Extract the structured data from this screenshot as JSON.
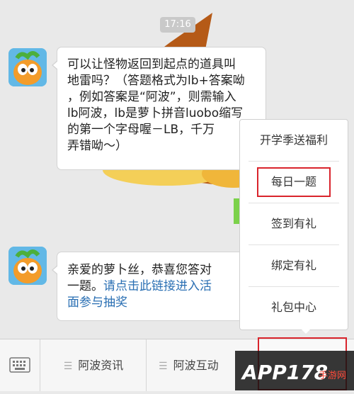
{
  "chat": {
    "time": "17:16",
    "msg1": {
      "lines": [
        "可以让怪物返回到起点的道具叫",
        "地雷吗？（答题格式为lb+答案呦",
        "，例如答案是“阿波”，则需输入",
        "lb阿波，lb是萝卜拼音luobo缩写",
        "的第一个字母喔－LB，千万",
        "弄错呦～）"
      ]
    },
    "msg2": {
      "line1": "亲爱的萝卜丝，恭喜您答对",
      "line2_text": "一题。",
      "line2_link": "请点击此链接进入活",
      "line3_link": "面参与抽奖"
    }
  },
  "menu": {
    "items": [
      "开学季送福利",
      "每日一题",
      "签到有礼",
      "绑定有礼",
      "礼包中心"
    ]
  },
  "toolbar": {
    "keyboard_icon": "keyboard-icon",
    "items": [
      "阿波资讯",
      "阿波互动"
    ]
  },
  "watermark": {
    "main": "APP178",
    "sub": "手游网"
  },
  "colors": {
    "highlight": "#d9242c",
    "link": "#2a6fb3"
  }
}
